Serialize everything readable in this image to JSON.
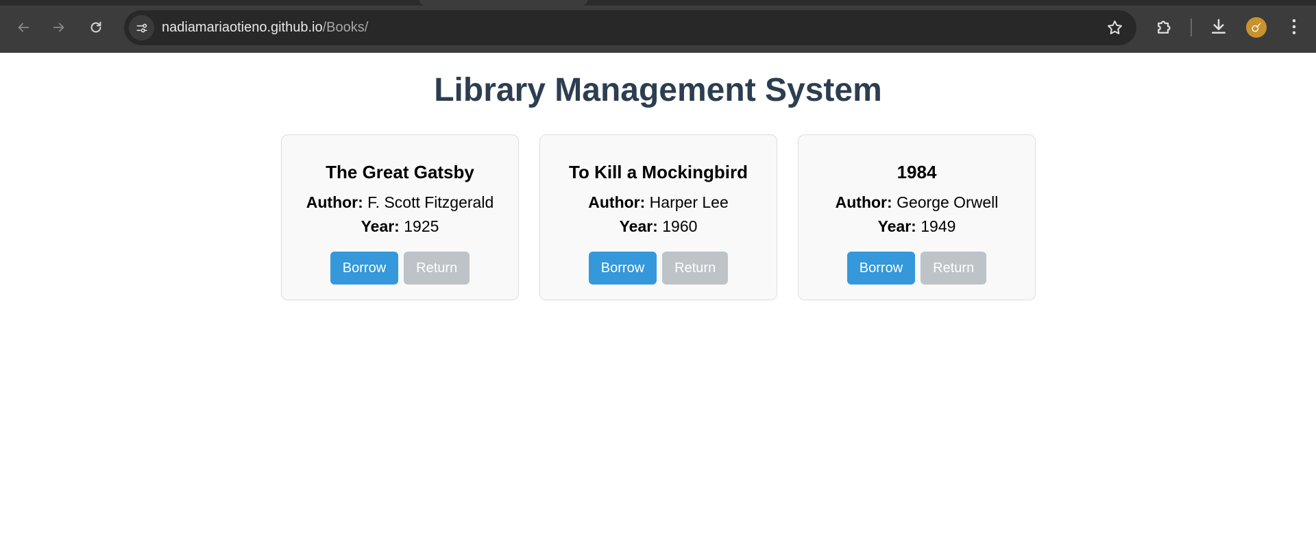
{
  "browser": {
    "url_host": "nadiamariaotieno.github.io",
    "url_path": "/Books/",
    "icons": [
      "back-arrow-icon",
      "forward-arrow-icon",
      "reload-icon",
      "site-info-icon",
      "bookmark-star-icon",
      "extensions-icon",
      "download-icon",
      "profile-avatar-icon",
      "more-menu-icon"
    ]
  },
  "page": {
    "title": "Library Management System"
  },
  "labels": {
    "author": "Author:",
    "year": "Year:"
  },
  "books": [
    {
      "title": "The Great Gatsby",
      "author": "F. Scott Fitzgerald",
      "year": "1925",
      "borrow_label": "Borrow",
      "return_label": "Return"
    },
    {
      "title": "To Kill a Mockingbird",
      "author": "Harper Lee",
      "year": "1960",
      "borrow_label": "Borrow",
      "return_label": "Return"
    },
    {
      "title": "1984",
      "author": "George Orwell",
      "year": "1949",
      "borrow_label": "Borrow",
      "return_label": "Return"
    }
  ],
  "colors": {
    "title": "#2c3e50",
    "borrow_button": "#3498db",
    "return_button": "#bdc3c7",
    "card_background": "#f9f9f9",
    "chrome_background": "#3c3c3c"
  }
}
